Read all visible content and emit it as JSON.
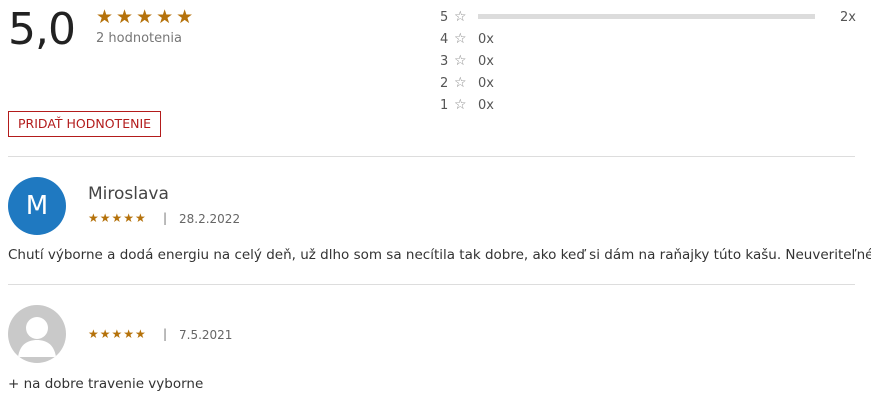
{
  "summary": {
    "score": "5,0",
    "stars": "★★★★★",
    "count_label": "2 hodnotenia"
  },
  "distribution": [
    {
      "stars": "5",
      "count": "2x",
      "fraction": 1.0
    },
    {
      "stars": "4",
      "count": "0x",
      "fraction": 0
    },
    {
      "stars": "3",
      "count": "0x",
      "fraction": 0
    },
    {
      "stars": "2",
      "count": "0x",
      "fraction": 0
    },
    {
      "stars": "1",
      "count": "0x",
      "fraction": 0
    }
  ],
  "add_button_label": "PRIDAŤ HODNOTENIE",
  "reviews": [
    {
      "avatar_letter": "M",
      "avatar_color": "#1f79c1",
      "name": "Miroslava",
      "stars": "★★★★★",
      "separator": "|",
      "date": "28.2.2022",
      "text": "Chutí výborne a dodá energiu na celý deň, už dlho som sa necítila tak dobre, ako keď si dám na raňajky túto kašu. Neuveriteľné:-)."
    },
    {
      "avatar_letter": "",
      "avatar_color": "#c9c9c9",
      "name": "",
      "stars": "★★★★★",
      "separator": "|",
      "date": "7.5.2021",
      "text": "+ na dobre travenie vyborne"
    }
  ],
  "accent_color": "#b5720b",
  "button_color": "#b31b1b"
}
